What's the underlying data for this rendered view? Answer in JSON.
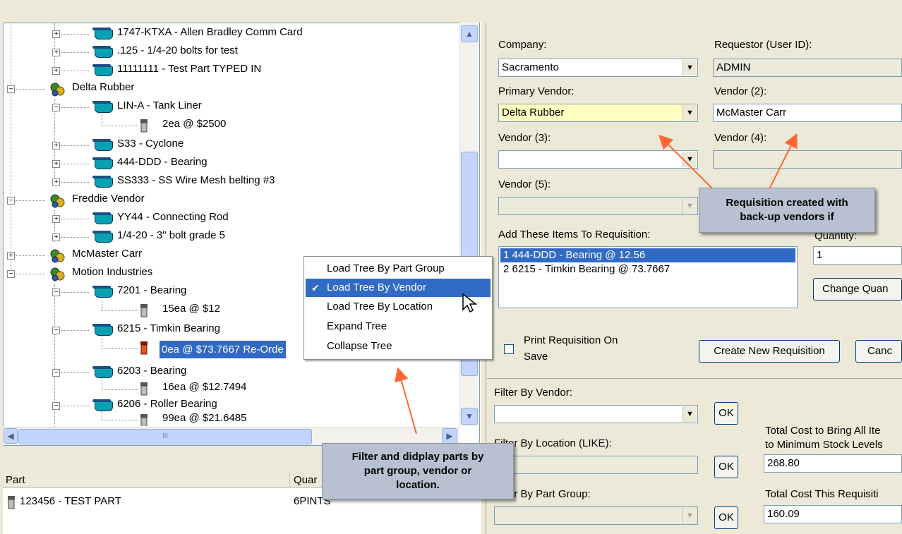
{
  "tree": {
    "rows": [
      {
        "label": "1747-KTXA - Allen Bradley Comm Card"
      },
      {
        "label": ".125 - 1/4-20 bolts for test"
      },
      {
        "label": "11111111 - Test Part TYPED IN"
      },
      {
        "label": "Delta Rubber"
      },
      {
        "label": "LIN-A - Tank Liner"
      },
      {
        "label": "2ea @ $2500"
      },
      {
        "label": "S33 - Cyclone"
      },
      {
        "label": "444-DDD - Bearing"
      },
      {
        "label": "SS333 - SS Wire Mesh belting #3"
      },
      {
        "label": "Freddie Vendor"
      },
      {
        "label": "YY44 - Connecting Rod"
      },
      {
        "label": "1/4-20 - 3\" bolt grade 5"
      },
      {
        "label": "McMaster Carr"
      },
      {
        "label": "Motion Industries"
      },
      {
        "label": "7201 - Bearing"
      },
      {
        "label": "15ea @ $12"
      },
      {
        "label": "6215 - Timkin Bearing"
      },
      {
        "label": "0ea @ $73.7667 Re-Orde"
      },
      {
        "label": "6203 - Bearing"
      },
      {
        "label": "16ea @ $12.7494"
      },
      {
        "label": "6206 - Roller Bearing"
      },
      {
        "label": "99ea @ $21.6485"
      }
    ],
    "hscroll_grip": "III"
  },
  "parts_list": {
    "col_part": "Part",
    "col_qty": "Quar",
    "rows": [
      {
        "part": "123456 - TEST PART",
        "qty": "6PINTS"
      }
    ]
  },
  "context_menu": {
    "items": [
      {
        "label": "Load Tree By Part Group"
      },
      {
        "label": "Load Tree By Vendor",
        "checked": true
      },
      {
        "label": "Load Tree By Location"
      },
      {
        "label": "Expand Tree"
      },
      {
        "label": "Collapse Tree"
      }
    ],
    "check_glyph": "✔"
  },
  "form": {
    "company_label": "Company:",
    "company_value": "Sacramento",
    "requestor_label": "Requestor (User ID):",
    "requestor_value": "ADMIN",
    "primary_vendor_label": "Primary Vendor:",
    "primary_vendor_value": "Delta Rubber",
    "vendor2_label": "Vendor (2):",
    "vendor2_value": "McMaster Carr",
    "vendor3_label": "Vendor (3):",
    "vendor4_label": "Vendor (4):",
    "vendor5_label": "Vendor (5):",
    "add_items_label": "Add These Items To Requisition:",
    "requisition_items": [
      "1 444-DDD - Bearing @ 12.56",
      "2 6215 - Timkin Bearing @ 73.7667"
    ],
    "quantity_label": "Quantity:",
    "quantity_value": "1",
    "change_qty_button": "Change Quan",
    "print_checkbox_label_1": "Print Requisition On",
    "print_checkbox_label_2": "Save",
    "create_button": "Create New Requisition",
    "cancel_button": "Canc",
    "filter_vendor_label": "Filter By Vendor:",
    "filter_location_label": "Filter By Location (LIKE):",
    "filter_group_label": "Filter By Part Group:",
    "ok_label": "OK",
    "total_min_label_1": "Total Cost to Bring All Ite",
    "total_min_label_2": "to Minimum Stock Levels",
    "total_min_value": "268.80",
    "total_req_label": "Total Cost This Requisiti",
    "total_req_value": "160.09"
  },
  "callouts": {
    "vendors_line1": "Requisition created with",
    "vendors_line2": "back-up vendors if",
    "filter_line1": "Filter and didplay parts by",
    "filter_line2": "part group, vendor or",
    "filter_line3": "location."
  },
  "colors": {
    "selection": "#316ac5",
    "primary_vendor_bg": "#ffffc0",
    "callout_bg": "#b8c1d1",
    "arrow": "#ff6633"
  }
}
